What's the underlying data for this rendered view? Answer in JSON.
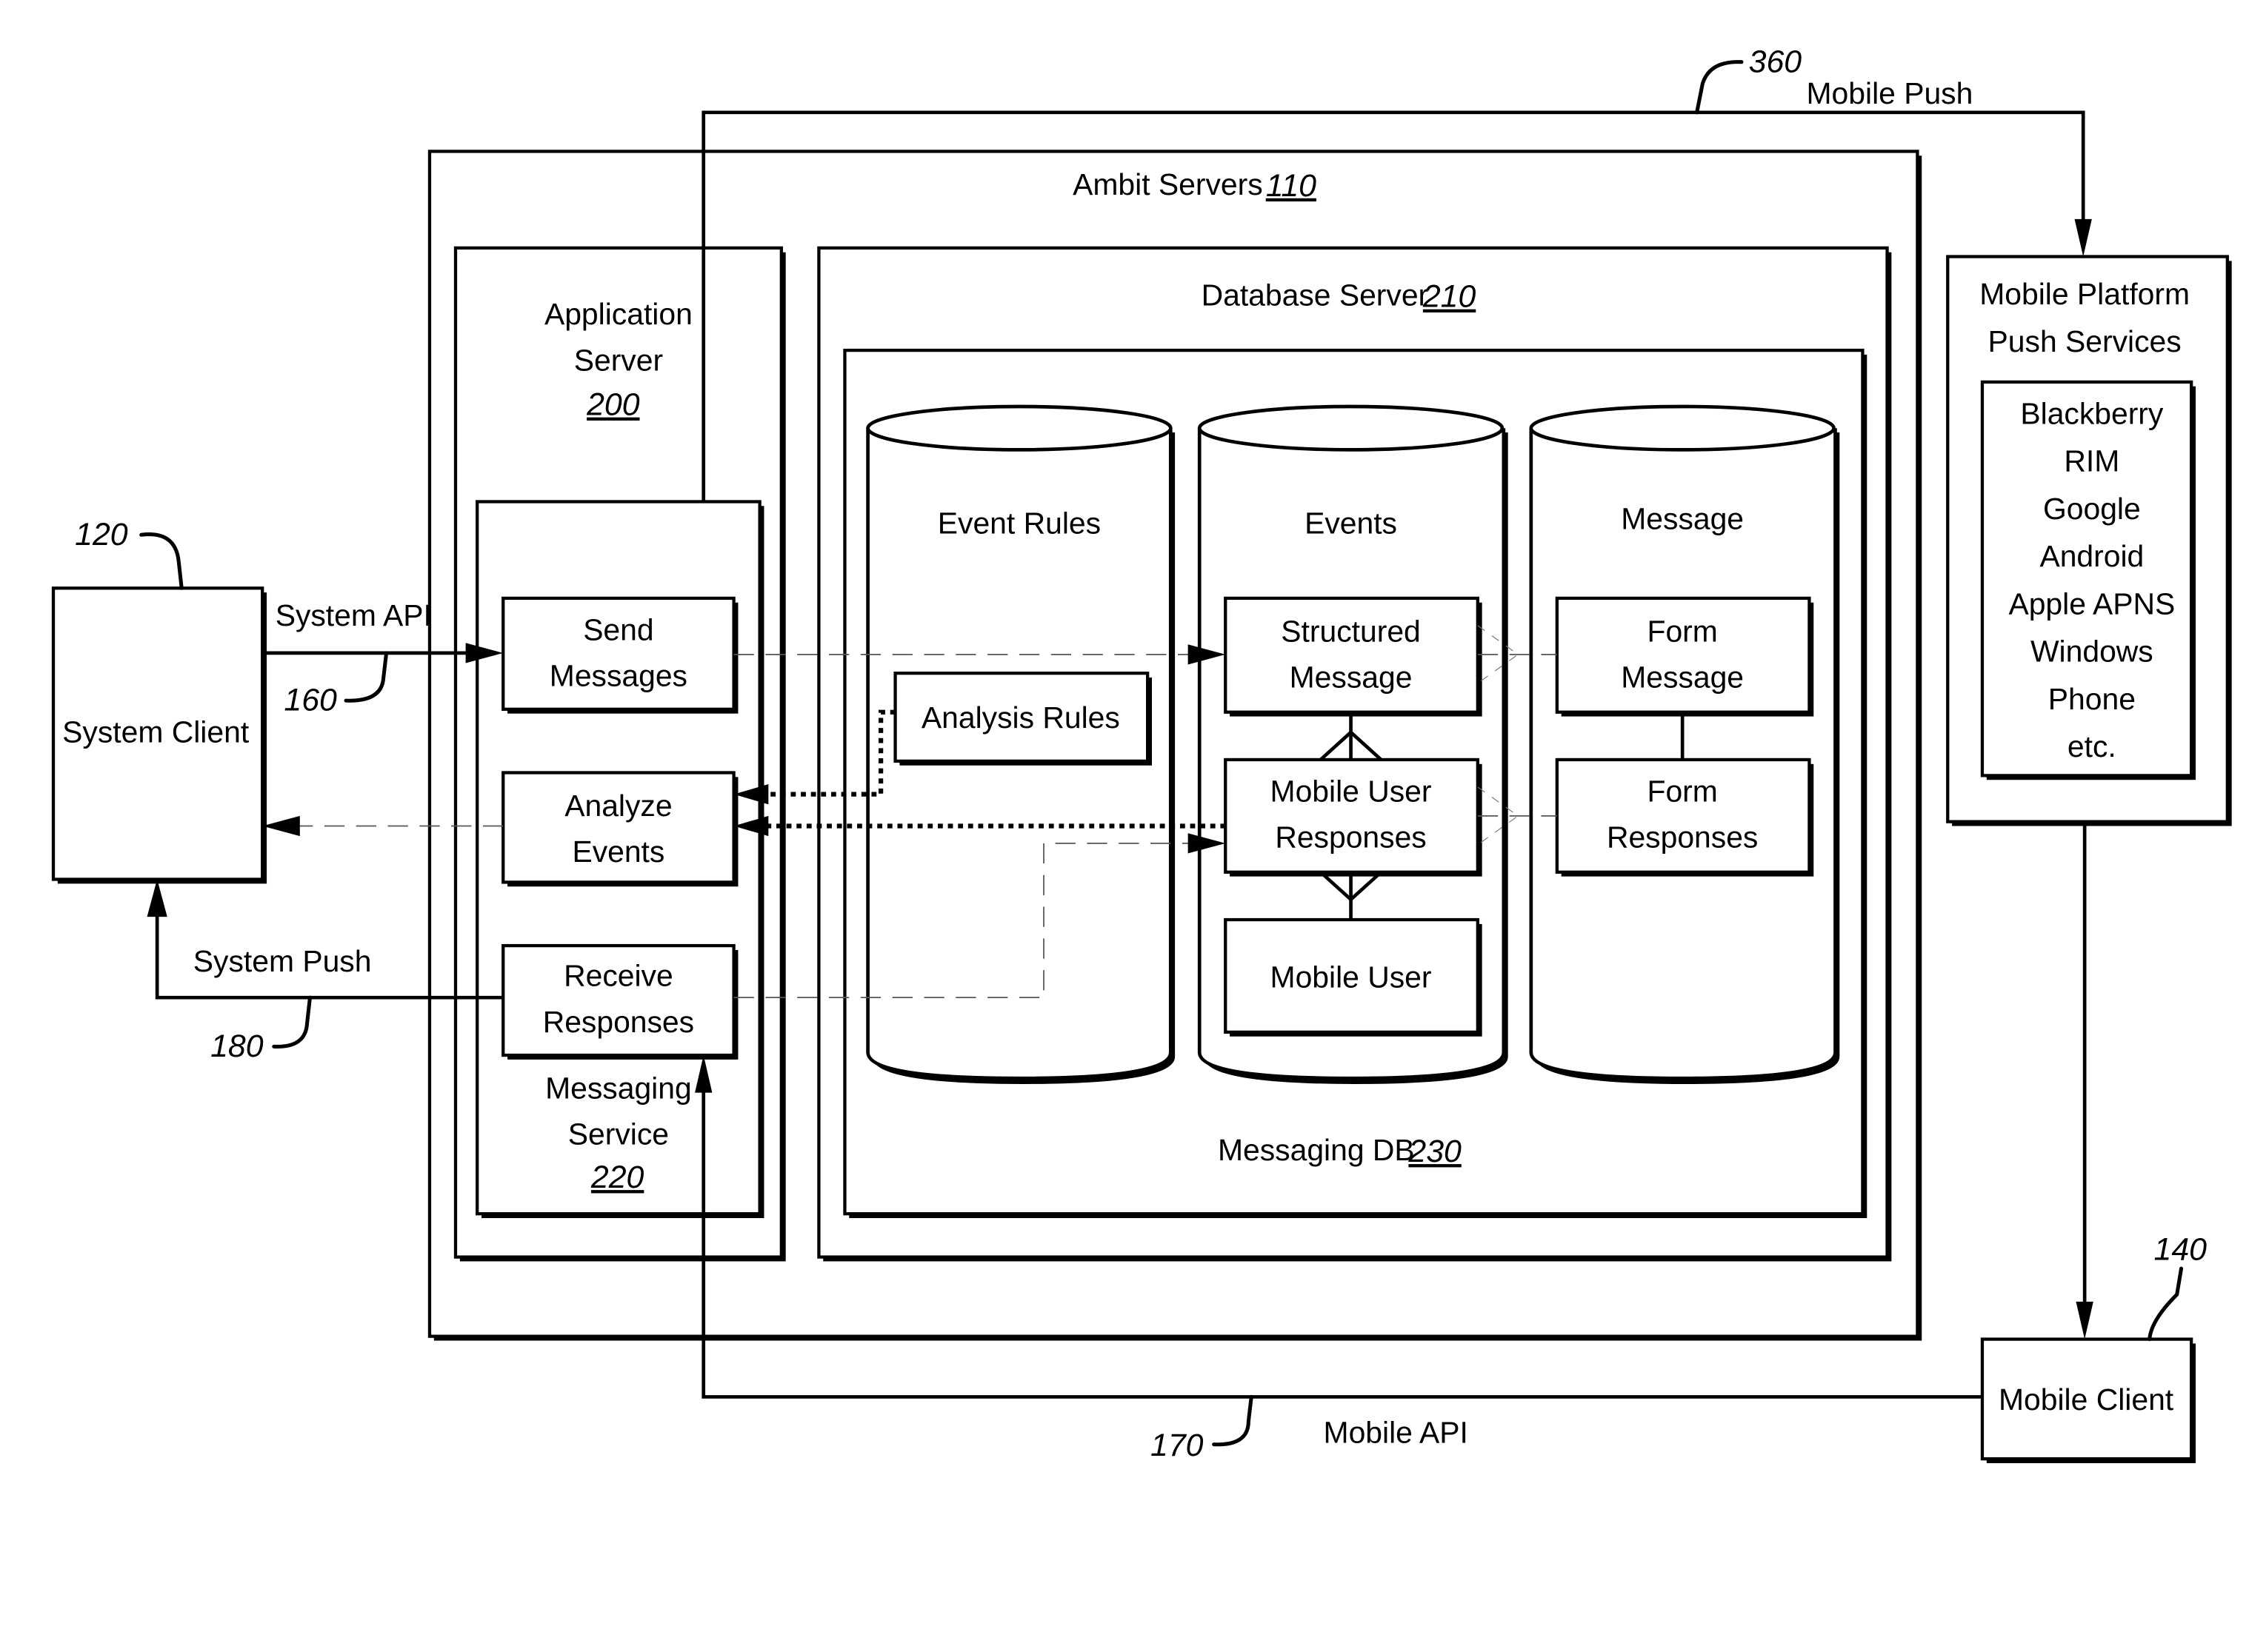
{
  "figure": {
    "ambit_servers": {
      "label": "Ambit Servers",
      "ref": "110"
    },
    "application_server": {
      "line1": "Application",
      "line2": "Server",
      "ref": "200"
    },
    "messaging_service": {
      "line1": "Messaging",
      "line2": "Service",
      "ref": "220"
    },
    "send_messages": {
      "line1": "Send",
      "line2": "Messages"
    },
    "analyze_events": {
      "line1": "Analyze",
      "line2": "Events"
    },
    "receive_responses": {
      "line1": "Receive",
      "line2": "Responses"
    },
    "database_server": {
      "label": "Database Server",
      "ref": "210"
    },
    "messaging_db": {
      "label": "Messaging DB",
      "ref": "230"
    },
    "cylinders": {
      "event_rules": {
        "label": "Event Rules",
        "analysis_rules": "Analysis Rules"
      },
      "events": {
        "label": "Events",
        "structured_message": {
          "line1": "Structured",
          "line2": "Message"
        },
        "mobile_user_responses": {
          "line1": "Mobile User",
          "line2": "Responses"
        },
        "mobile_user": "Mobile User"
      },
      "message": {
        "label": "Message",
        "form_message": {
          "line1": "Form",
          "line2": "Message"
        },
        "form_responses": {
          "line1": "Form",
          "line2": "Responses"
        }
      }
    },
    "system_client": {
      "label": "System Client",
      "ref": "120"
    },
    "mobile_client": {
      "label": "Mobile Client",
      "ref": "140"
    },
    "mobile_platform": {
      "line1": "Mobile Platform",
      "line2": "Push Services",
      "services": [
        "Blackberry",
        "RIM",
        "Google",
        "Android",
        "Apple APNS",
        "Windows",
        "Phone",
        "etc."
      ]
    },
    "connections": {
      "system_api": {
        "label": "System API",
        "ref": "160"
      },
      "system_push": {
        "label": "System Push",
        "ref": "180"
      },
      "mobile_api": {
        "label": "Mobile API",
        "ref": "170"
      },
      "mobile_push": {
        "label": "Mobile Push",
        "ref": "360"
      }
    }
  }
}
